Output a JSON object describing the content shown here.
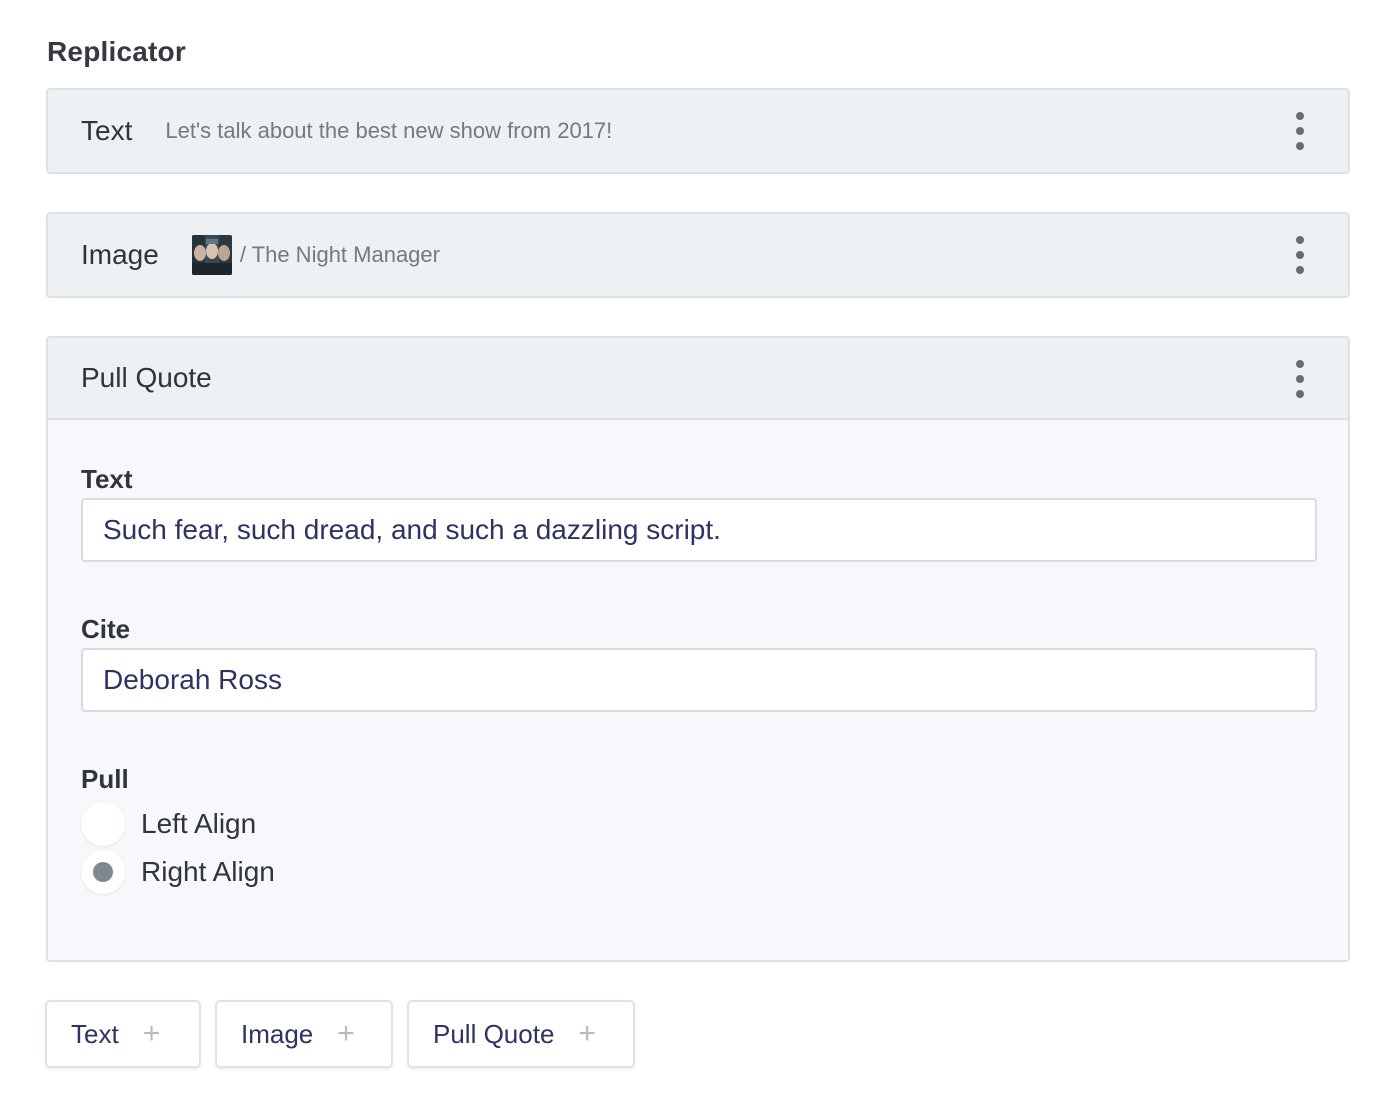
{
  "field": {
    "title": "Replicator"
  },
  "sets": {
    "text": {
      "name": "Text",
      "preview": "Let's talk about the best new show from 2017!"
    },
    "image": {
      "name": "Image",
      "preview": "/ The Night Manager",
      "thumb_icon": "image-thumbnail"
    },
    "quote": {
      "name": "Pull Quote",
      "fields": {
        "text_label": "Text",
        "text_value": "Such fear, such dread, and such a dazzling script.",
        "cite_label": "Cite",
        "cite_value": "Deborah Ross",
        "pull_label": "Pull",
        "options": [
          "Left Align",
          "Right Align"
        ],
        "selected": "Right Align"
      }
    }
  },
  "add_buttons": [
    "Text",
    "Image",
    "Pull Quote"
  ],
  "colors": {
    "header_bg": "#eef1f4",
    "body_bg": "#f6f8fb",
    "input_text": "#2e3362",
    "border": "#dde2e7"
  }
}
